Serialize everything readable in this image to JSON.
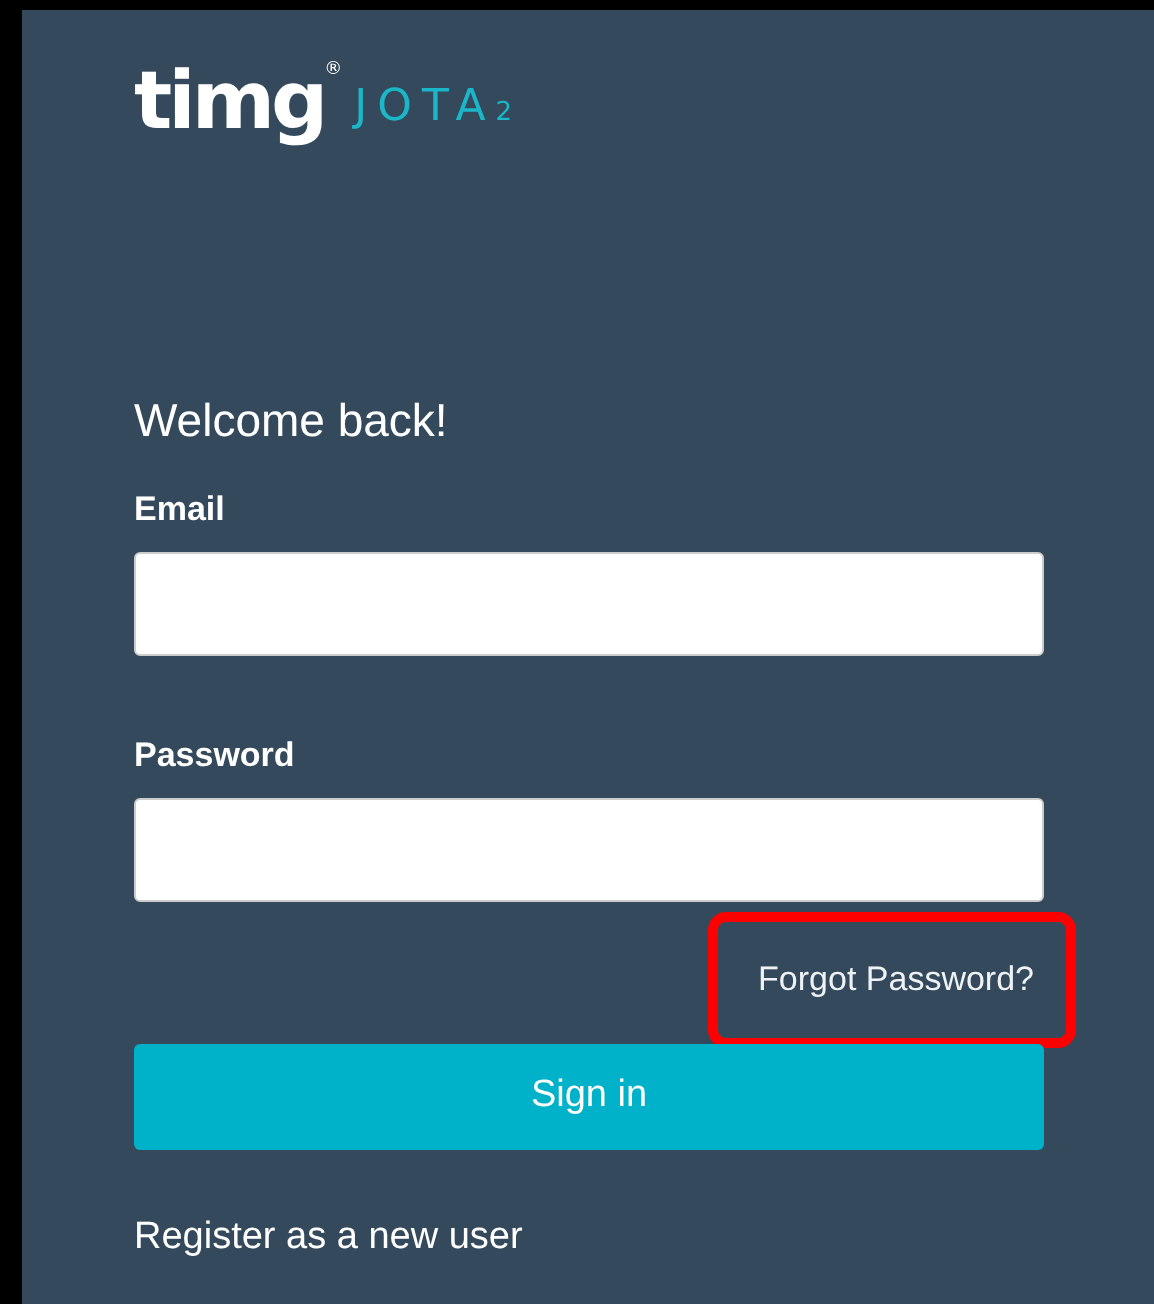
{
  "logo": {
    "brand": "timg",
    "registered": "®",
    "product": "JOTA",
    "version": "2"
  },
  "heading": "Welcome back!",
  "fields": [
    {
      "label": "Email"
    },
    {
      "label": "Password"
    }
  ],
  "forgot_link": {
    "label": "Forgot Password?",
    "highlighted": true
  },
  "sign_in_button": "Sign in",
  "register_link": "Register as a new user"
}
